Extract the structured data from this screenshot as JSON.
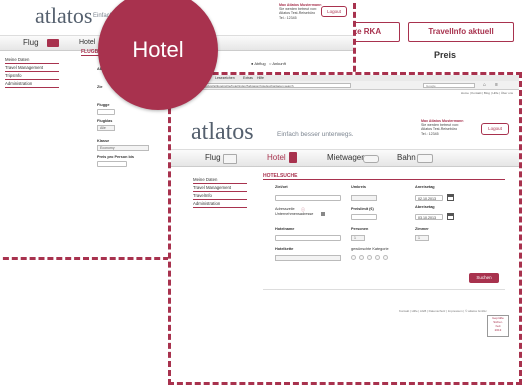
{
  "badge": {
    "label": "Hotel"
  },
  "right_panel": {
    "tabs": [
      "ehmigte RKA",
      "TravelInfo aktuell"
    ],
    "preis": "Preis"
  },
  "back": {
    "logo": "atlatos",
    "tagline": "Einfach besser",
    "user": [
      "Max Atlatos Mustermann",
      "Sie werden betreut von:",
      "Atlatos Test-Reisebüro",
      "Tel.: 12345"
    ],
    "logout": "Logout",
    "nav": [
      "Flug",
      "Hotel"
    ],
    "sidebar": [
      "Meine Daten",
      "Travel Management",
      "TripsInfo",
      "Administration"
    ],
    "section": "FLUGBU",
    "radio": [
      "Abflug",
      "Ankunft"
    ],
    "labels": [
      "Ab",
      "Zie",
      "Flugge",
      "Flugklas",
      "Klasse",
      "Preis pro Person bis"
    ],
    "flugklasse_value": "Alle",
    "klasse_value": "Economy"
  },
  "browser": {
    "menu": [
      "Lesezeichen",
      "Extras",
      "Hilfe"
    ],
    "url": "www.atlatos.de/atlatos/ui2/atlfoget/write/hotel/index?tabpage=hotelsuchanlagen.search",
    "search_placeholder": "Google",
    "toplinks": "Home | Kontakt | Blog | Hilfe | Über uns"
  },
  "front": {
    "logo": "atlatos",
    "tagline": "Einfach besser unterwegs.",
    "user": [
      "Max Atlatos Mustermann",
      "Sie werden betreut von:",
      "Atlatos Test-Reisebüro",
      "Tel.: 12345"
    ],
    "logout": "Logout",
    "nav": [
      "Flug",
      "Hotel",
      "Mietwagen",
      "Bahn"
    ],
    "sidebar": [
      "Meine Daten",
      "Travel Management",
      "TravelInfo",
      "Administration"
    ],
    "section": "HOTELSUCHE",
    "fields": {
      "ziel": "Ziel/ort",
      "umkreis": "Umkreis",
      "anreise": "Anreisetag",
      "anreise_value": "02.10.2013",
      "adresszeile": "Adresszeile",
      "unternehmensadresse": "Unternehmensadresse",
      "preislimit": "Preislimit (€)",
      "abreise": "Abreisetag",
      "abreise_value": "03.10.2013",
      "hotelname": "Hotelname",
      "personen": "Personen",
      "personen_value": "1",
      "zimmer": "Zimmer",
      "zimmer_value": "1",
      "hotelkette": "Hotelkette",
      "kategorie": "gewünschte Kategorie"
    },
    "search_button": "Suchen",
    "footer": "Kontakt | Hilfe | AGB | Datenschutz | Impressum | © atlatos GmbH",
    "seal": [
      "Geprüfte",
      "Sicher-",
      "heit",
      "2013"
    ]
  }
}
